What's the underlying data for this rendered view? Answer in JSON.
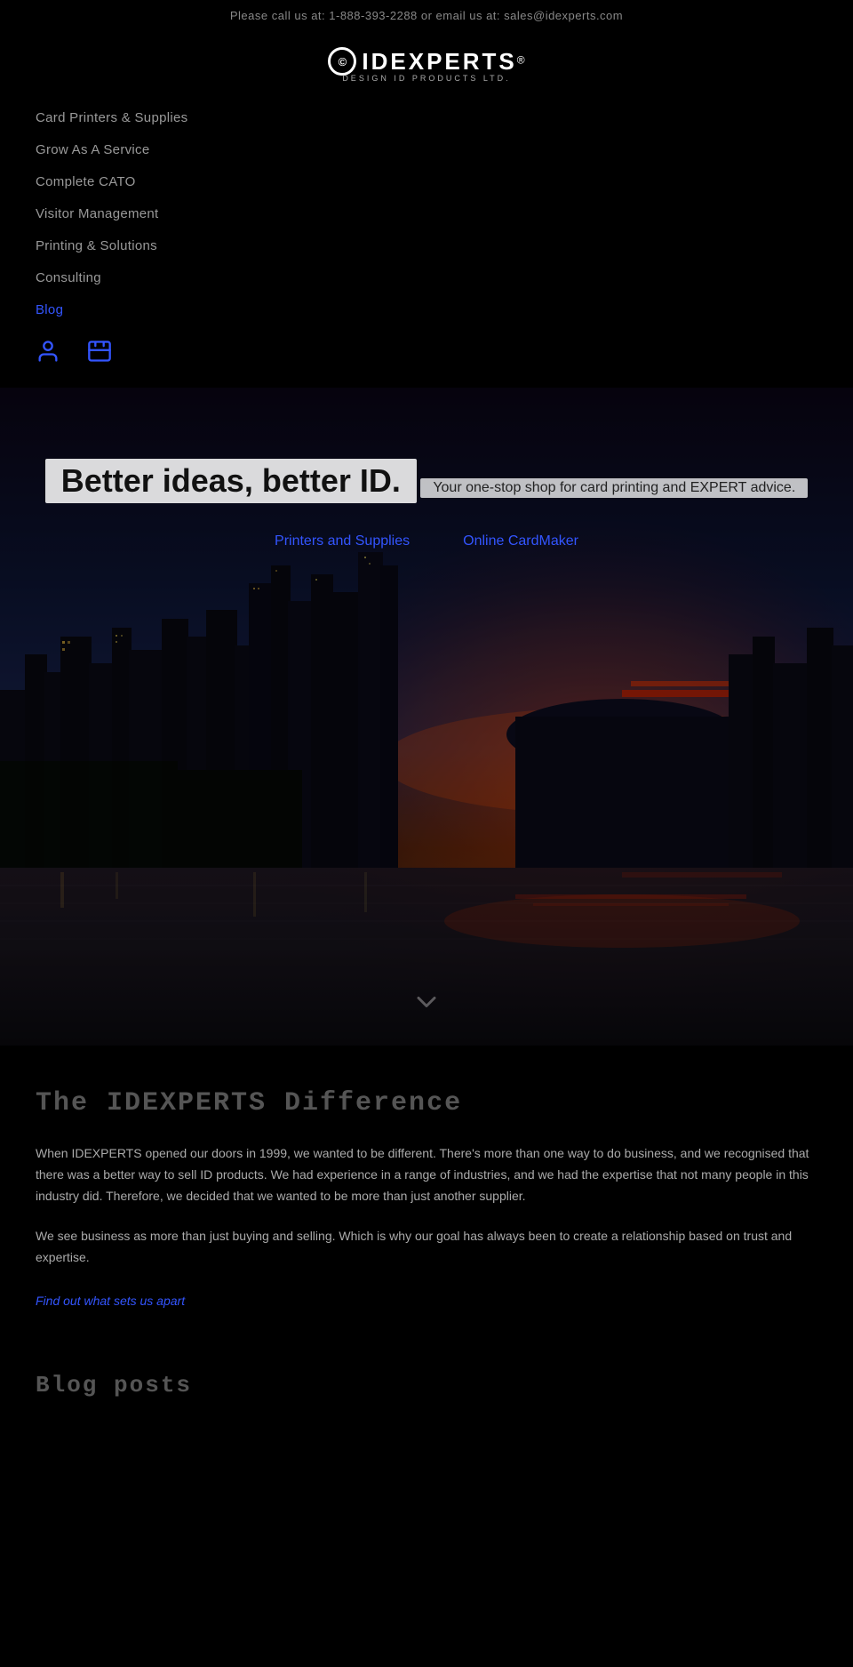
{
  "topbar": {
    "text": "Please call us at: 1-888-393-2288 or email us at: sales@idexperts.com",
    "phone": "1-888-393-2288",
    "email": "sales@idexperts.com"
  },
  "logo": {
    "brand": "IDEXPERTS",
    "registered": "®",
    "tagline": "DESIGN ID PRODUCTS LTD."
  },
  "nav": {
    "items": [
      {
        "label": "Card Printers & Supplies",
        "href": "#",
        "active": false
      },
      {
        "label": "Grow As A Service",
        "href": "#",
        "active": false
      },
      {
        "label": "Complete CATO",
        "href": "#",
        "active": false
      },
      {
        "label": "Visitor Management",
        "href": "#",
        "active": false
      },
      {
        "label": "Printing & Solutions",
        "href": "#",
        "active": false
      },
      {
        "label": "Consulting",
        "href": "#",
        "active": false
      },
      {
        "label": "Blog",
        "href": "#",
        "active": true
      }
    ],
    "icons": {
      "account": "👤",
      "cart": "🛒"
    }
  },
  "hero": {
    "title": "Better ideas, better ID.",
    "subtitle": "Your one-stop shop for card printing and EXPERT advice.",
    "btn1": "Printers and Supplies",
    "btn2": "Online CardMaker"
  },
  "about": {
    "section_title": "The IDEXPERTS Difference",
    "para1": "When IDEXPERTS opened our doors in 1999, we wanted to be different. There's more than one way to do business, and we recognised that there was a better way to sell ID products. We had experience in a range of industries, and we had the expertise that not many people in this industry did. Therefore, we decided that we wanted to be more than just another supplier.",
    "para2": "We see business as more than just buying and selling. Which is why our goal has always been to create a relationship based on trust and expertise.",
    "link": "Find out what sets us apart"
  },
  "blog": {
    "section_title": "Blog posts"
  }
}
